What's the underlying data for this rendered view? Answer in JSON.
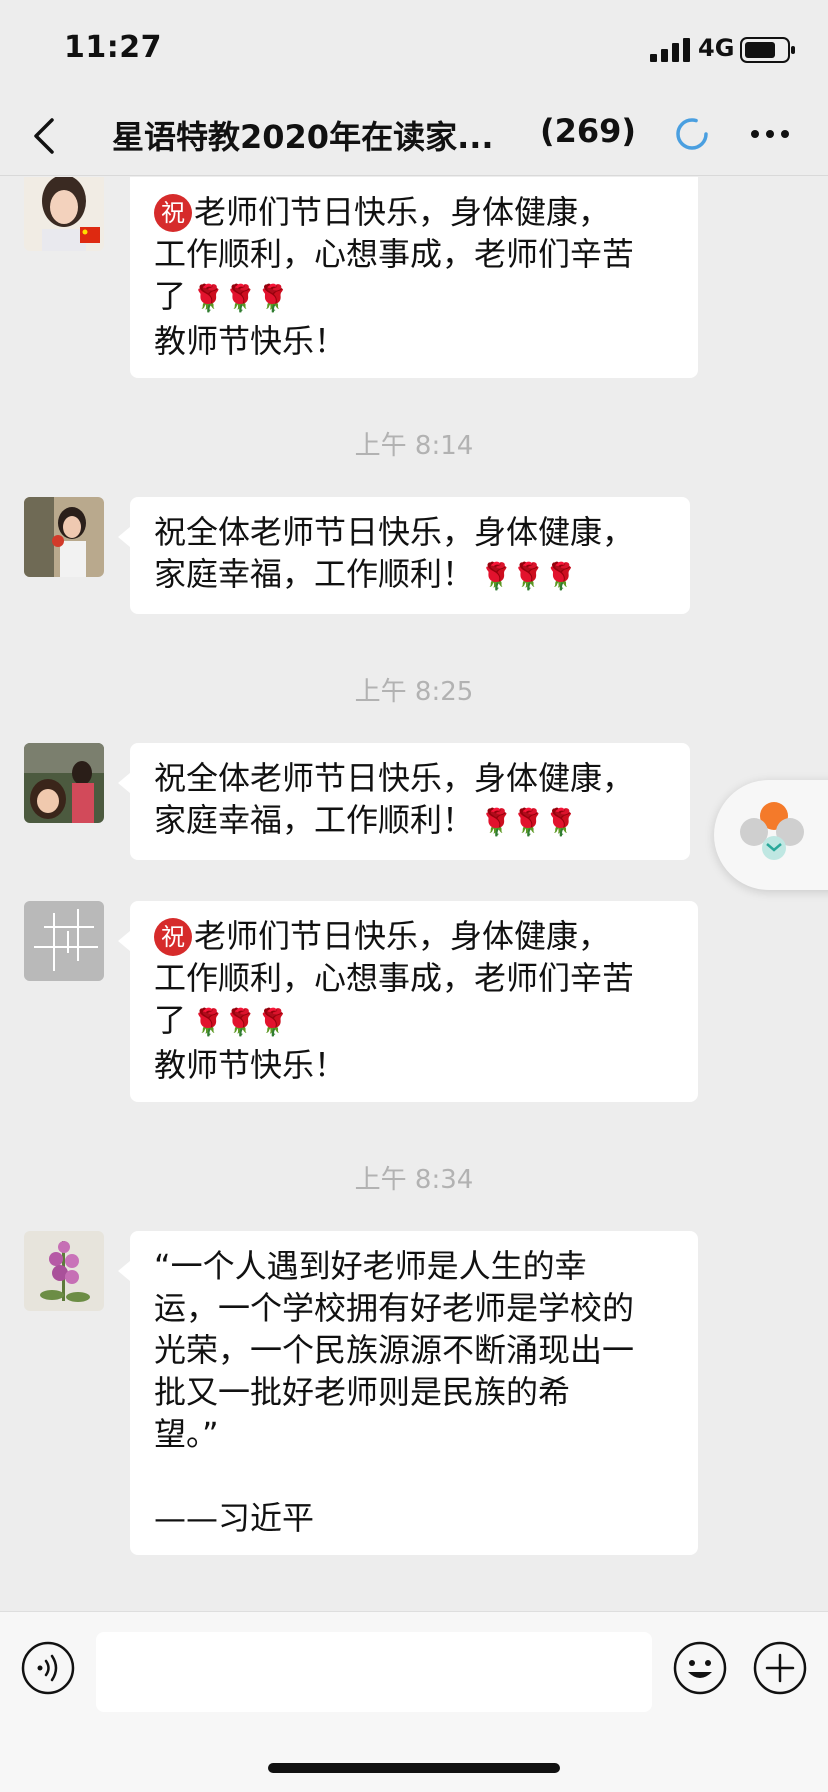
{
  "status_bar": {
    "time": "11:27",
    "network": "4G"
  },
  "nav": {
    "title": "星语特教2020年在读家...",
    "member_count": "(269)"
  },
  "messages": [
    {
      "badge": "祝",
      "lines": [
        "老师们节日快乐，身体健康，",
        "工作顺利，心想事成，老师们辛苦",
        "了",
        "教师节快乐！"
      ],
      "roses": "🌹🌹🌹"
    },
    {
      "timestamp": "上午 8:14",
      "lines": [
        "祝全体老师节日快乐，身体健康，",
        "家庭幸福，工作顺利！"
      ],
      "roses": "🌹🌹🌹"
    },
    {
      "timestamp": "上午 8:25",
      "lines": [
        "祝全体老师节日快乐，身体健康，",
        "家庭幸福，工作顺利！"
      ],
      "roses": "🌹🌹🌹"
    },
    {
      "badge": "祝",
      "lines": [
        "老师们节日快乐，身体健康，",
        "工作顺利，心想事成，老师们辛苦",
        "了",
        "教师节快乐！"
      ],
      "roses": "🌹🌹🌹"
    },
    {
      "timestamp": "上午 8:34",
      "lines": [
        "“一个人遇到好老师是人生的幸",
        "运，一个学校拥有好老师是学校的",
        "光荣，一个民族源源不断涌现出一",
        "批又一批好老师则是民族的希",
        "望。”",
        "",
        "——习近平"
      ]
    }
  ],
  "input": {
    "placeholder": ""
  },
  "colors": {
    "accent_blue": "#4a9fe0",
    "badge_red": "#d62b2b",
    "background": "#ededed"
  }
}
